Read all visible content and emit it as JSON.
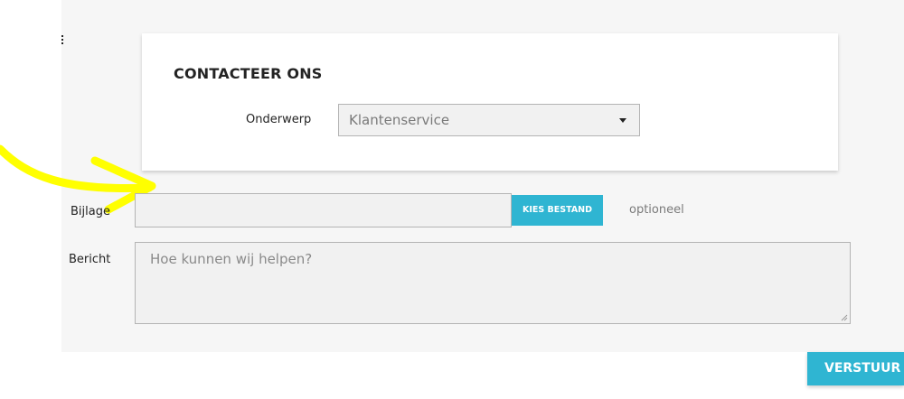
{
  "contact": {
    "title": "CONTACTEER ONS",
    "subject_label": "Onderwerp",
    "subject_value": "Klantenservice"
  },
  "attachment": {
    "label": "Bijlage",
    "input_value": "",
    "choose_file_label": "KIES BESTAND",
    "optional_note": "optioneel"
  },
  "message": {
    "label": "Bericht",
    "placeholder": "Hoe kunnen wij helpen?"
  },
  "submit": {
    "label": "VERSTUUR"
  },
  "colors": {
    "accent": "#2fb5d2",
    "highlight_arrow": "#ffff00",
    "page_gray": "#f6f6f6"
  },
  "icons": {
    "select_caret": "caret-down-icon",
    "resize_handle": "resize-handle-icon",
    "menu": "kebab-menu-icon",
    "annotation": "yellow-arrow-annotation"
  }
}
